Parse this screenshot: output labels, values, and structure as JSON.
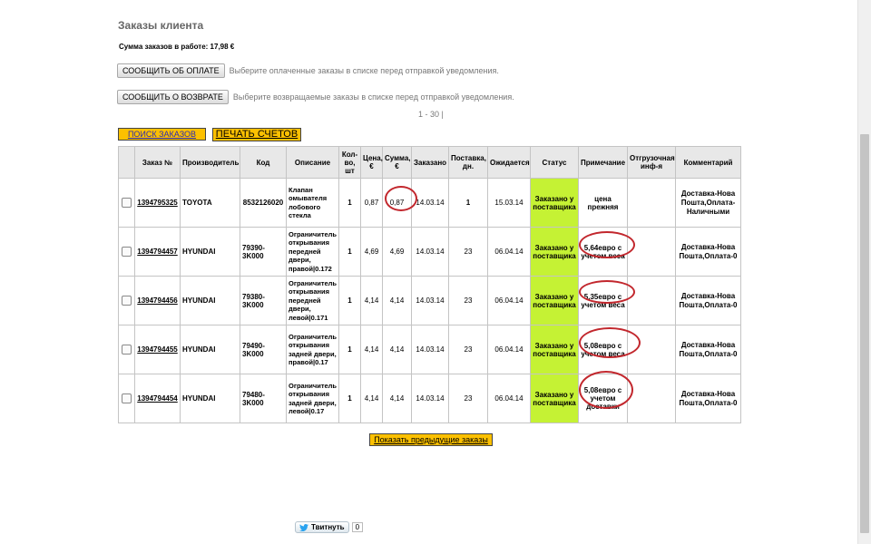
{
  "page": {
    "title": "Заказы клиента",
    "total": "Сумма заказов в работе: 17,98 €",
    "pay_button": "СООБЩИТЬ ОБ ОПЛАТЕ",
    "pay_hint": "Выберите оплаченные заказы в списке перед отправкой уведомления.",
    "return_button": "СООБЩИТЬ О ВОЗВРАТЕ",
    "return_hint": "Выберите возвращаемые заказы в списке перед отправкой уведомления.",
    "pager": "1 - 30 |",
    "search_button": "ПОИСК ЗАКАЗОВ",
    "print_button": "ПЕЧАТЬ СЧЕТОВ",
    "show_prev": "Показать предыдущие заказы",
    "tweet_label": "Твитнуть",
    "tweet_count": "0"
  },
  "table": {
    "headers": [
      "Заказ №",
      "Производитель",
      "Код",
      "Описание",
      "Кол-во, шт",
      "Цена, €",
      "Сумма, €",
      "Заказано",
      "Поставка, дн.",
      "Ожидается",
      "Статус",
      "Примечание",
      "Отгрузочная инф-я",
      "Комментарий"
    ],
    "rows": [
      {
        "order": "1394795325",
        "maker": "TOYOTA",
        "code": "8532126020",
        "desc": "Клапан омывателя лобового стекла",
        "qty": "1",
        "price": "0,87",
        "sum": "0,87",
        "ordered": "14.03.14",
        "days": "1",
        "expected": "15.03.14",
        "status": "Заказано у поставщика",
        "note": "цена прежняя",
        "ship": "",
        "comment": "Доставка-Нова Пошта,Оплата-Наличными"
      },
      {
        "order": "1394794457",
        "maker": "HYUNDAI",
        "code": "79390-3K000",
        "desc": "Ограничитель открывания передней двери, правой|0.172",
        "qty": "1",
        "price": "4,69",
        "sum": "4,69",
        "ordered": "14.03.14",
        "days": "23",
        "expected": "06.04.14",
        "status": "Заказано у поставщика",
        "note": "5,64евро с учетом веса",
        "ship": "",
        "comment": "Доставка-Нова Пошта,Оплата-0"
      },
      {
        "order": "1394794456",
        "maker": "HYUNDAI",
        "code": "79380-3K000",
        "desc": "Ограничитель открывания передней двери, левой|0.171",
        "qty": "1",
        "price": "4,14",
        "sum": "4,14",
        "ordered": "14.03.14",
        "days": "23",
        "expected": "06.04.14",
        "status": "Заказано у поставщика",
        "note": "5,35евро с учетом веса",
        "ship": "",
        "comment": "Доставка-Нова Пошта,Оплата-0"
      },
      {
        "order": "1394794455",
        "maker": "HYUNDAI",
        "code": "79490-3K000",
        "desc": "Ограничитель открывания задней двери, правой|0.17",
        "qty": "1",
        "price": "4,14",
        "sum": "4,14",
        "ordered": "14.03.14",
        "days": "23",
        "expected": "06.04.14",
        "status": "Заказано у поставщика",
        "note": "5,08евро с учетом веса",
        "ship": "",
        "comment": "Доставка-Нова Пошта,Оплата-0"
      },
      {
        "order": "1394794454",
        "maker": "HYUNDAI",
        "code": "79480-3K000",
        "desc": "Ограничитель открывания задней двери, левой|0.17",
        "qty": "1",
        "price": "4,14",
        "sum": "4,14",
        "ordered": "14.03.14",
        "days": "23",
        "expected": "06.04.14",
        "status": "Заказано у поставщика",
        "note": "5,08евро с учетом доставки",
        "ship": "",
        "comment": "Доставка-Нова Пошта,Оплата-0"
      }
    ]
  },
  "colors": {
    "accent": "#fcc000",
    "status": "#c5f234",
    "annotation": "#c2272d"
  }
}
